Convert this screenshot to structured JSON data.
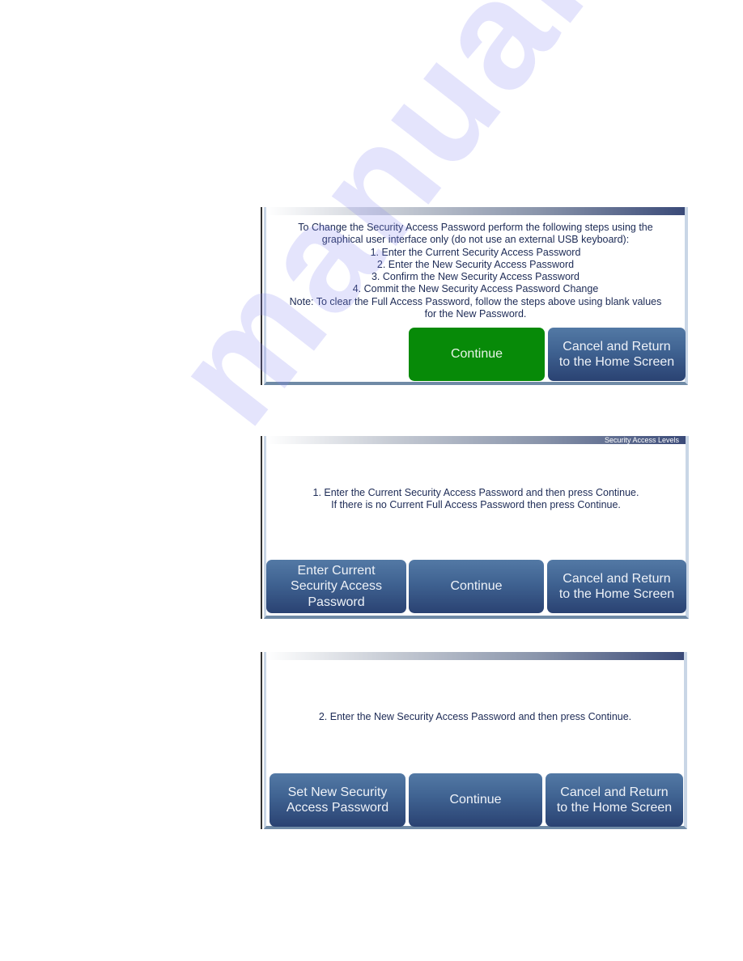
{
  "watermark": "manualshive.com",
  "screens": [
    {
      "title": "",
      "message_lines": [
        "To Change the Security Access Password perform the following steps using the",
        "graphical user interface only (do not use an external USB keyboard):",
        "1. Enter the Current Security Access Password",
        "2. Enter the New Security Access Password",
        "3. Confirm the New Security Access Password",
        "4. Commit the New Security Access Password Change",
        "Note: To clear the Full Access Password, follow the steps above using blank values",
        "for the New Password."
      ],
      "buttons": [
        {
          "label": "Continue",
          "color": "#078a08"
        },
        {
          "label": "Cancel and Return\nto the Home Screen",
          "color": "#3f6291"
        }
      ]
    },
    {
      "title": "Security Access Levels",
      "message_lines": [
        "1. Enter the Current Security Access Password and then press Continue.",
        "If there is no Current Full Access Password then press Continue."
      ],
      "buttons": [
        {
          "label": "Enter Current\nSecurity Access\nPassword"
        },
        {
          "label": "Continue"
        },
        {
          "label": "Cancel and Return\nto the Home Screen"
        }
      ]
    },
    {
      "title": "",
      "message_lines": [
        "2. Enter the New Security Access Password and then press Continue."
      ],
      "buttons": [
        {
          "label": "Set New Security\nAccess Password"
        },
        {
          "label": "Continue"
        },
        {
          "label": "Cancel and Return\nto the Home Screen"
        }
      ]
    }
  ]
}
